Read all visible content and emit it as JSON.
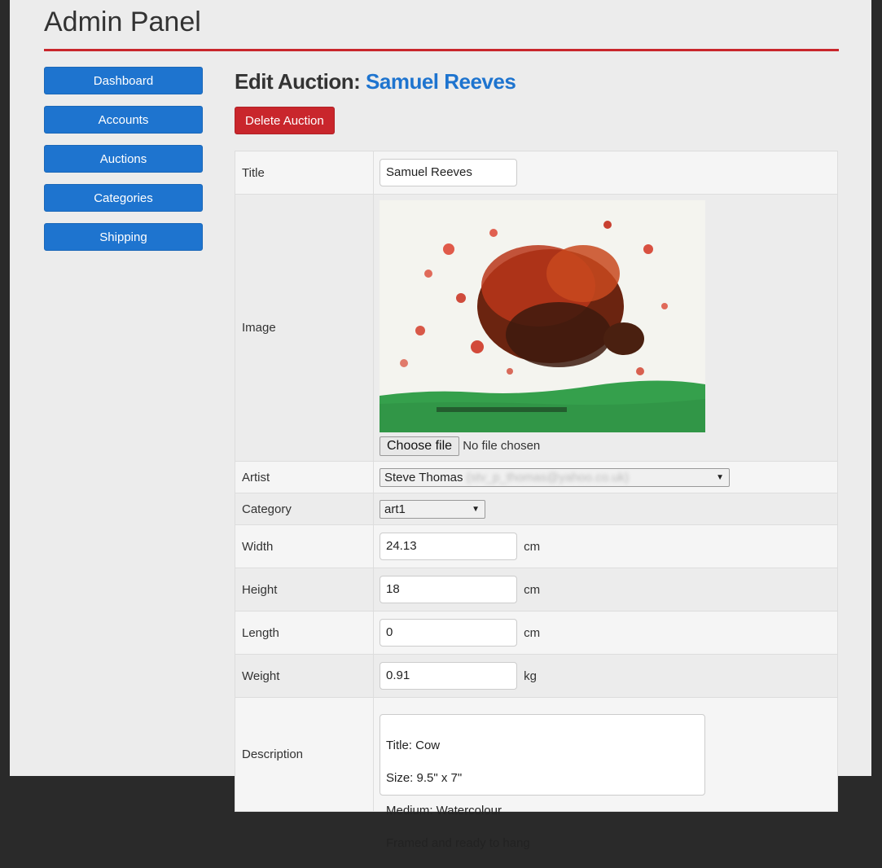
{
  "header": {
    "title": "Admin Panel"
  },
  "sidebar": {
    "items": [
      {
        "label": "Dashboard"
      },
      {
        "label": "Accounts"
      },
      {
        "label": "Auctions"
      },
      {
        "label": "Categories"
      },
      {
        "label": "Shipping"
      }
    ]
  },
  "main": {
    "heading_prefix": "Edit Auction:",
    "heading_name": "Samuel Reeves",
    "delete_label": "Delete Auction"
  },
  "form": {
    "title": {
      "label": "Title",
      "value": "Samuel Reeves"
    },
    "image": {
      "label": "Image",
      "file_button": "Choose file",
      "file_status": "No file chosen"
    },
    "artist": {
      "label": "Artist",
      "value": "Steve Thomas",
      "email": "(stv_p_thomas@yahoo.co.uk)"
    },
    "category": {
      "label": "Category",
      "value": "art1"
    },
    "width": {
      "label": "Width",
      "value": "24.13",
      "unit": "cm"
    },
    "height": {
      "label": "Height",
      "value": "18",
      "unit": "cm"
    },
    "length": {
      "label": "Length",
      "value": "0",
      "unit": "cm"
    },
    "weight": {
      "label": "Weight",
      "value": "0.91",
      "unit": "kg"
    },
    "description": {
      "label": "Description",
      "lines": [
        "Title: Cow",
        "Size: 9.5\" x 7\"",
        "Medium: Watercolour",
        "Framed and ready to hang"
      ]
    }
  },
  "colors": {
    "accent_blue": "#1e74cf",
    "danger_red": "#c9262c"
  }
}
